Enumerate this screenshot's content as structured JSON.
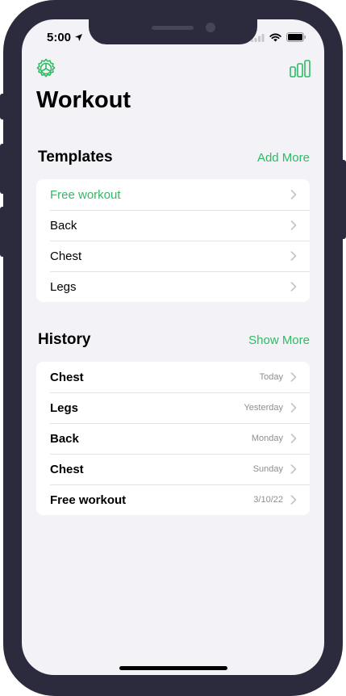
{
  "status_bar": {
    "time": "5:00"
  },
  "header": {
    "title": "Workout"
  },
  "templates": {
    "title": "Templates",
    "action": "Add More",
    "items": [
      {
        "label": "Free workout"
      },
      {
        "label": "Back"
      },
      {
        "label": "Chest"
      },
      {
        "label": "Legs"
      }
    ]
  },
  "history": {
    "title": "History",
    "action": "Show More",
    "items": [
      {
        "label": "Chest",
        "date": "Today"
      },
      {
        "label": "Legs",
        "date": "Yesterday"
      },
      {
        "label": "Back",
        "date": "Monday"
      },
      {
        "label": "Chest",
        "date": "Sunday"
      },
      {
        "label": "Free workout",
        "date": "3/10/22"
      }
    ]
  },
  "colors": {
    "accent": "#2ebb64",
    "background": "#f2f2f7",
    "frame": "#2b2b3d"
  },
  "icons": {
    "settings": "settings-icon",
    "stats": "bar-chart-icon",
    "chevron": "chevron-right-icon",
    "location": "location-arrow-icon",
    "signal": "cellular-signal-icon",
    "wifi": "wifi-icon",
    "battery": "battery-icon"
  }
}
